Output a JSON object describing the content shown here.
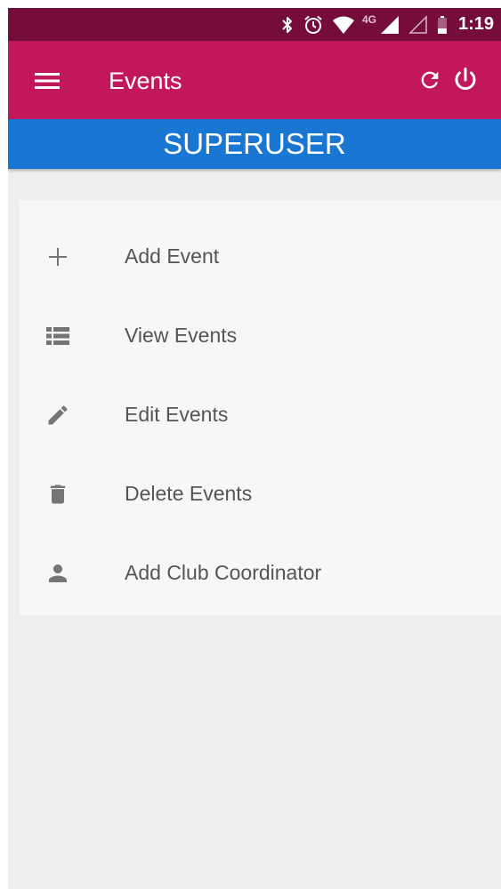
{
  "status_bar": {
    "network": "4G",
    "time": "1:19",
    "icons": [
      "bluetooth-icon",
      "alarm-icon",
      "wifi-icon",
      "signal-icon",
      "signal-empty-icon",
      "battery-icon"
    ]
  },
  "app_bar": {
    "title": "Events",
    "color": "#c2185b",
    "status_color": "#760c39"
  },
  "role_banner": {
    "text": "SUPERUSER",
    "color": "#1976d2"
  },
  "menu": {
    "items": [
      {
        "label": "Add Event",
        "icon": "plus-icon"
      },
      {
        "label": "View Events",
        "icon": "list-icon"
      },
      {
        "label": "Edit Events",
        "icon": "pencil-icon"
      },
      {
        "label": "Delete Events",
        "icon": "trash-icon"
      },
      {
        "label": "Add Club Coordinator",
        "icon": "person-icon"
      }
    ]
  }
}
